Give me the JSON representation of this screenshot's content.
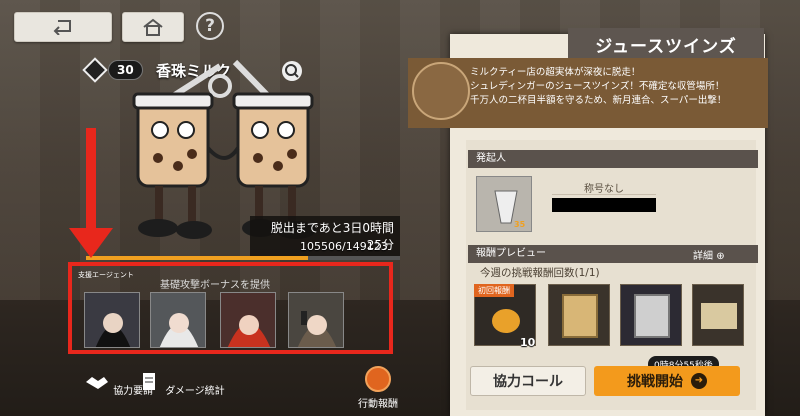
{
  "top": {
    "help_label": "?"
  },
  "boss": {
    "level": "30",
    "name": "香珠ミルク",
    "escape_timer": "脱出まであと3日0時間25分",
    "hp_text": "105506/149123",
    "hp_fraction": 0.7075
  },
  "agents": {
    "tag": "支援エージェント",
    "description": "基礎攻撃ボーナスを提供"
  },
  "bottom_left": {
    "coop_request": "協力要請",
    "damage_stats": "ダメージ統計",
    "action_reward": "行動報酬"
  },
  "panel": {
    "title": "ジュースツインズ",
    "description_lines": [
      "ミルクティー店の超実体が深夜に脱走！",
      "シュレディンガーのジュースツインズ！不確定な収管場所！",
      "千万人の二杯目半額を守るため、新月連合、スーパー出撃！"
    ],
    "initiator_header": "発起人",
    "initiator_title": "称号なし",
    "initiator_level": "35",
    "reward_header": "報酬プレビュー",
    "detail_label": "詳細",
    "challenge_count": "今週の挑戦報酬回数(1/1)",
    "first_clear_tag": "初回報酬",
    "first_reward_qty": "10",
    "coop_call": "協力コール",
    "challenge_start": "挑戦開始",
    "timer": "0時8分55秒後"
  },
  "colors": {
    "highlight": "#e8271c",
    "accent_orange": "#f39a1c"
  }
}
